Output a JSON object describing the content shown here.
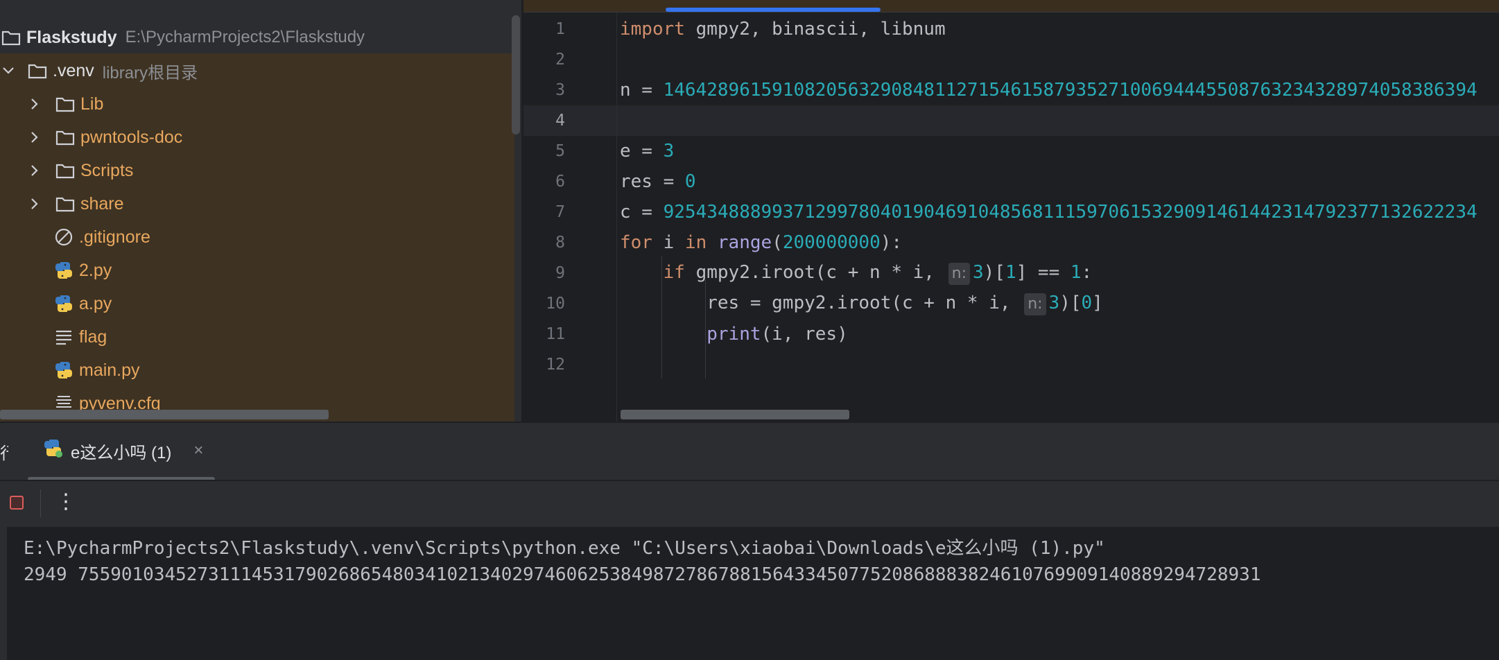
{
  "project_tree": {
    "root": {
      "name": "Flaskstudy",
      "path": "E:\\PycharmProjects2\\Flaskstudy"
    },
    "venv": {
      "name": ".venv",
      "hint": "library根目录"
    },
    "items": [
      {
        "name": "Lib",
        "icon": "folder-icon"
      },
      {
        "name": "pwntools-doc",
        "icon": "folder-icon"
      },
      {
        "name": "Scripts",
        "icon": "folder-icon"
      },
      {
        "name": "share",
        "icon": "folder-icon"
      },
      {
        "name": ".gitignore",
        "icon": "ignore-file-icon"
      },
      {
        "name": "2.py",
        "icon": "python-file-icon"
      },
      {
        "name": "a.py",
        "icon": "python-file-icon"
      },
      {
        "name": "flag",
        "icon": "text-file-icon"
      },
      {
        "name": "main.py",
        "icon": "python-file-icon"
      },
      {
        "name": "pyvenv.cfg",
        "icon": "config-file-icon"
      }
    ]
  },
  "editor": {
    "line_numbers": [
      "1",
      "2",
      "3",
      "4",
      "5",
      "6",
      "7",
      "8",
      "9",
      "10",
      "11",
      "12"
    ],
    "current_line": "4",
    "code": {
      "l1_kw": "import",
      "l1_rest": " gmpy2, binascii, libnum",
      "l3_prefix": "n = ",
      "l3_value": "146428961591082056329084811271546158793527100694445508763234328974058386394",
      "l5_prefix": "e = ",
      "l5_value": "3",
      "l6_prefix": "res = ",
      "l6_value": "0",
      "l7_prefix": "c = ",
      "l7_value": "925434888993712997804019046910485681115970615329091461442314792377132622234",
      "l8_for": "for",
      "l8_i": " i ",
      "l8_in": "in",
      "l8_range": "range",
      "l8_open": "(",
      "l8_num": "200000000",
      "l8_close": "):",
      "l9_if": "if",
      "l9_a": " gmpy2.iroot(c + n * i, ",
      "l9_hint": "n:",
      "l9_3": "3",
      "l9_b": ")[",
      "l9_1": "1",
      "l9_c": "] == ",
      "l9_1b": "1",
      "l9_d": ":",
      "l10_a": "res = gmpy2.iroot(c + n * i, ",
      "l10_hint": "n:",
      "l10_3": "3",
      "l10_b": ")[",
      "l10_0": "0",
      "l10_c": "]",
      "l11_print": "print",
      "l11_rest": "(i, res)"
    }
  },
  "run": {
    "title_fragment": "行",
    "tab_label": "e这么小吗 (1)",
    "close": "×",
    "more": "⋮",
    "console": [
      "E:\\PycharmProjects2\\Flaskstudy\\.venv\\Scripts\\python.exe \"C:\\Users\\xiaobai\\Downloads\\e这么小吗 (1).py\"",
      "2949 7559010345273111453179026865480341021340297460625384987278678815643345077520868883824610769909140889294728931"
    ]
  },
  "colors": {
    "keyword": "#cf8e6d",
    "number": "#2aacb8",
    "builtin": "#a9a4e0",
    "folder_name": "#e8a85f",
    "accent": "#3574f0",
    "stop": "#db5c5c"
  }
}
